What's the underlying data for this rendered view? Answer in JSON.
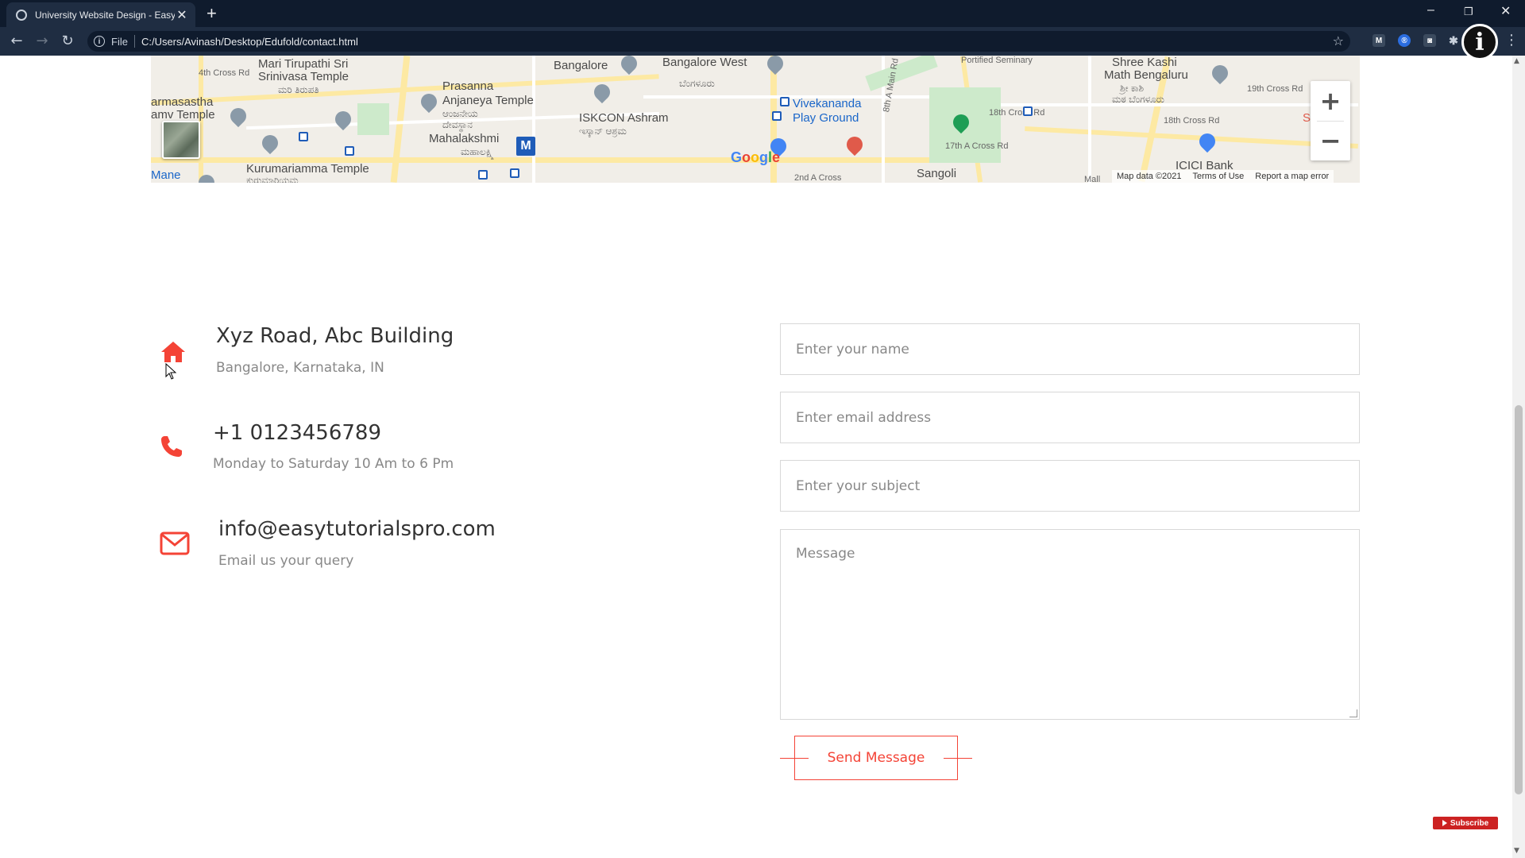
{
  "browser": {
    "tab_title": "University Website Design - Easy",
    "tab_close": "✕",
    "new_tab": "+",
    "scheme": "File",
    "url": "C:/Users/Avinash/Desktop/Edufold/contact.html",
    "win_minimize": "–",
    "win_restore": "❐",
    "win_close": "✕"
  },
  "map": {
    "labels": {
      "l1": "Mari Tirupathi Sri",
      "l2": "Srinivasa Temple",
      "l3": "ಮರಿ ತಿರುಪತಿ",
      "l4": "4th Cross Rd",
      "l5": "armasastha",
      "l6": "amv Temple",
      "l7": "Prasanna",
      "l8": "Anjaneya Temple",
      "l9": "ಆಂಜನೇಯ",
      "l10": "ದೇವಸ್ಥಾನ",
      "l11": "Mahalakshmi",
      "l12": "ಮಹಾಲಕ್ಷ್ಮಿ",
      "l13": "Bangalore",
      "l14": "Bangalore West",
      "l15": "ಬೆಂಗಳೂರು",
      "l16": "ISKCON Ashram",
      "l17": "ಇಸ್ಕಾನ್ ಆಶ್ರಮ",
      "l18": "Vivekananda",
      "l19": "Play Ground",
      "l20": "8th A Main Rd",
      "l21": "Shree Kashi",
      "l22": "Math Bengaluru",
      "l23": "ಶ್ರೀ ಕಾಶಿ",
      "l24": "ಮಠ ಬೆಂಗಳೂರು",
      "l25": "19th Cross Rd",
      "l26": "18th Cross Rd",
      "l27": "18th Cross Rd",
      "l28": "17th A Cross Rd",
      "l29": "ICICI Bank",
      "l30": "Kurumariamma Temple",
      "l31": "ಕುರುಮಾರಿಯಮ್ಮ",
      "l32": "Mane",
      "l33": "2nd A Cross",
      "l34": "Sangoli",
      "l35": "Mall",
      "l36": "S",
      "l37": "Portified Seminary"
    },
    "google": [
      "G",
      "o",
      "o",
      "g",
      "l",
      "e"
    ],
    "google_colors": [
      "#4285F4",
      "#EA4335",
      "#FBBC05",
      "#4285F4",
      "#34A853",
      "#EA4335"
    ],
    "zoom_in": "+",
    "zoom_out": "−",
    "footer": {
      "map_data": "Map data ©2021",
      "terms": "Terms of Use",
      "report": "Report a map error"
    }
  },
  "contact": {
    "address_title": "Xyz Road, Abc Building",
    "address_sub": "Bangalore, Karnataka, IN",
    "phone_title": "+1 0123456789",
    "phone_sub": "Monday to Saturday 10 Am to 6 Pm",
    "email_title": "info@easytutorialspro.com",
    "email_sub": "Email us your query",
    "accent_color": "#f44336"
  },
  "form": {
    "name_placeholder": "Enter your name",
    "email_placeholder": "Enter email address",
    "subject_placeholder": "Enter your subject",
    "message_placeholder": "Message",
    "send_label": "Send Message"
  },
  "subscribe_label": "Subscribe"
}
